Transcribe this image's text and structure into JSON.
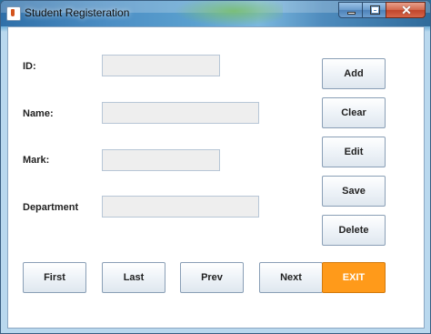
{
  "window": {
    "title": "Student Registeration",
    "controls": {
      "minimize": "minimize-icon",
      "maximize": "maximize-icon",
      "close": "close-icon"
    }
  },
  "form": {
    "fields": [
      {
        "label": "ID:",
        "value": ""
      },
      {
        "label": "Name:",
        "value": ""
      },
      {
        "label": "Mark:",
        "value": ""
      },
      {
        "label": "Department",
        "value": ""
      }
    ]
  },
  "side_buttons": {
    "add": "Add",
    "clear": "Clear",
    "edit": "Edit",
    "save": "Save",
    "delete": "Delete"
  },
  "nav_buttons": {
    "first": "First",
    "last": "Last",
    "prev": "Prev",
    "next": "Next",
    "exit": "EXIT"
  },
  "colors": {
    "exit_button": "#ff9a1a"
  }
}
